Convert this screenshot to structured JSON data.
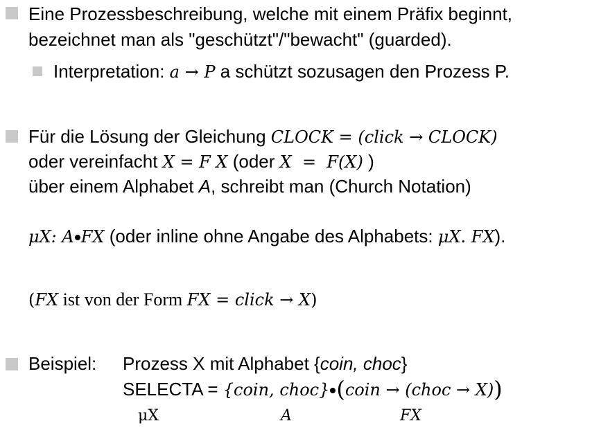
{
  "section1": {
    "line1": "Eine Prozessbeschreibung, welche mit einem Präfix beginnt,",
    "line2": "bezeichnet man als \"geschützt\"/\"bewacht\" (guarded).",
    "sub": {
      "prefix": "Interpretation: ",
      "math": "a → P",
      "suffix": " a schützt sozusagen den Prozess P."
    }
  },
  "section2": {
    "line1_prefix": "Für die Lösung der Gleichung ",
    "line1_math": "CLOCK = (click → CLOCK)",
    "line2_prefix": "oder vereinfacht ",
    "line2_math1": "X = F X",
    "line2_mid": " (oder ",
    "line2_math2": "X  =  F(X)",
    "line2_suffix": " )",
    "line3_prefix": "über einem Alphabet ",
    "line3_var": "A",
    "line3_suffix": ", schreibt man (Church Notation)",
    "line4_math1": "μX: A",
    "line4_math2": "FX",
    "line4_mid": " (oder inline ohne Angabe des Alphabets: ",
    "line4_math3": "μX. FX",
    "line4_suffix": ").",
    "line5_open": "(",
    "line5_math1": "FX",
    "line5_text": " ist von der Form ",
    "line5_math2": "FX = click → X",
    "line5_close": ")"
  },
  "section3": {
    "label": "Beispiel:",
    "line1_prefix": "Prozess X mit Alphabet {",
    "line1_italic": "coin, choc",
    "line1_suffix": "}",
    "line2_prefix": "SELECTA = ",
    "line2_set": "{coin, choc}",
    "line2_open": "(",
    "line2_inner": "coin → (choc → X)",
    "line2_close": ")",
    "under_mu": "μX",
    "under_a": "A",
    "under_fx": "FX"
  }
}
